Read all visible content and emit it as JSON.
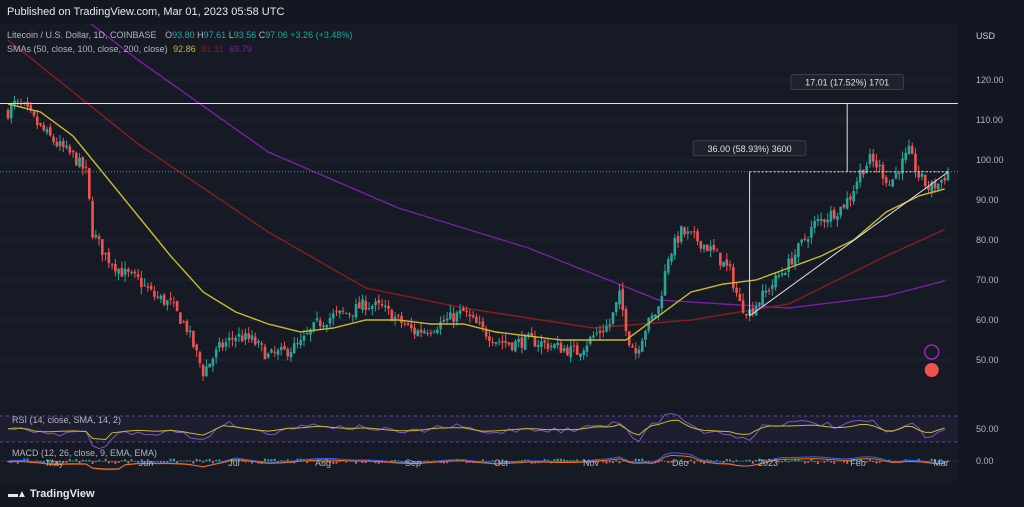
{
  "header": {
    "published": "Published on TradingView.com, Mar 01, 2023 05:58 UTC",
    "symbol_title": "Litecoin / U.S. Dollar, 1D, COINBASE",
    "ohlc": {
      "o_label": "O",
      "o": "93.80",
      "h_label": "H",
      "h": "97.61",
      "l_label": "L",
      "l": "93.56",
      "c_label": "C",
      "c": "97.06",
      "change": "+3.26 (+3.48%)"
    },
    "sma_label": "SMAs (50, close, 100, close, 200, close)",
    "sma_values": [
      "92.86",
      "81.31",
      "69.79"
    ],
    "currency": "USD"
  },
  "footer": {
    "brand": "TradingView"
  },
  "colors": {
    "background": "#161a25",
    "up": "#26a69a",
    "down": "#ef5350",
    "sma50": "#c9b92b",
    "sma100": "#8b1c1c",
    "sma200": "#7b1fa2",
    "rsi": "#7e57c2",
    "rsi_sma": "#c9b92b",
    "macd": "#2962ff",
    "signal": "#ff6d00"
  },
  "annotations": {
    "resistance_label": "114.12",
    "last_price_label": "97.06",
    "measure_big": "36.00 (58.93%) 3600",
    "measure_small": "17.01 (17.52%) 1701"
  },
  "chart_data": {
    "type": "candlestick",
    "title": "Litecoin / U.S. Dollar, 1D, COINBASE",
    "x_ticks": [
      "May",
      "Jun",
      "Jul",
      "Aug",
      "Sep",
      "Oct",
      "Nov",
      "Dec",
      "2023",
      "Feb",
      "Mar"
    ],
    "y_ticks": [
      "120.00",
      "110.00",
      "100.00",
      "90.00",
      "80.00",
      "70.00",
      "60.00",
      "50.00"
    ],
    "ylim": [
      44,
      124
    ],
    "price_path": [
      {
        "x": 0,
        "y": 112
      },
      {
        "x": 2,
        "y": 114
      },
      {
        "x": 5,
        "y": 113
      },
      {
        "x": 10,
        "y": 108
      },
      {
        "x": 15,
        "y": 104
      },
      {
        "x": 20,
        "y": 101
      },
      {
        "x": 24,
        "y": 97
      },
      {
        "x": 26,
        "y": 82
      },
      {
        "x": 30,
        "y": 76
      },
      {
        "x": 35,
        "y": 72
      },
      {
        "x": 40,
        "y": 70
      },
      {
        "x": 45,
        "y": 66
      },
      {
        "x": 50,
        "y": 64
      },
      {
        "x": 55,
        "y": 58
      },
      {
        "x": 60,
        "y": 47
      },
      {
        "x": 65,
        "y": 53
      },
      {
        "x": 70,
        "y": 56
      },
      {
        "x": 75,
        "y": 55
      },
      {
        "x": 80,
        "y": 51
      },
      {
        "x": 85,
        "y": 52
      },
      {
        "x": 90,
        "y": 54
      },
      {
        "x": 95,
        "y": 59
      },
      {
        "x": 100,
        "y": 61
      },
      {
        "x": 105,
        "y": 62
      },
      {
        "x": 110,
        "y": 64
      },
      {
        "x": 115,
        "y": 63
      },
      {
        "x": 120,
        "y": 60
      },
      {
        "x": 125,
        "y": 57
      },
      {
        "x": 130,
        "y": 58
      },
      {
        "x": 135,
        "y": 60
      },
      {
        "x": 140,
        "y": 62
      },
      {
        "x": 145,
        "y": 58
      },
      {
        "x": 150,
        "y": 55
      },
      {
        "x": 155,
        "y": 54
      },
      {
        "x": 160,
        "y": 55
      },
      {
        "x": 165,
        "y": 54
      },
      {
        "x": 170,
        "y": 53
      },
      {
        "x": 175,
        "y": 52
      },
      {
        "x": 180,
        "y": 56
      },
      {
        "x": 185,
        "y": 59
      },
      {
        "x": 188,
        "y": 66
      },
      {
        "x": 191,
        "y": 55
      },
      {
        "x": 193,
        "y": 52
      },
      {
        "x": 196,
        "y": 58
      },
      {
        "x": 200,
        "y": 63
      },
      {
        "x": 203,
        "y": 76
      },
      {
        "x": 207,
        "y": 82
      },
      {
        "x": 212,
        "y": 80
      },
      {
        "x": 217,
        "y": 77
      },
      {
        "x": 222,
        "y": 72
      },
      {
        "x": 225,
        "y": 64
      },
      {
        "x": 228,
        "y": 62
      },
      {
        "x": 232,
        "y": 66
      },
      {
        "x": 236,
        "y": 70
      },
      {
        "x": 240,
        "y": 74
      },
      {
        "x": 244,
        "y": 79
      },
      {
        "x": 248,
        "y": 84
      },
      {
        "x": 252,
        "y": 86
      },
      {
        "x": 256,
        "y": 88
      },
      {
        "x": 259,
        "y": 91
      },
      {
        "x": 262,
        "y": 97
      },
      {
        "x": 265,
        "y": 100
      },
      {
        "x": 268,
        "y": 98
      },
      {
        "x": 271,
        "y": 94
      },
      {
        "x": 274,
        "y": 98
      },
      {
        "x": 277,
        "y": 102
      },
      {
        "x": 280,
        "y": 96
      },
      {
        "x": 283,
        "y": 93
      },
      {
        "x": 286,
        "y": 94
      },
      {
        "x": 289,
        "y": 97.06
      }
    ],
    "sma_path": [
      {
        "x": 0,
        "y": 114
      },
      {
        "x": 10,
        "y": 112
      },
      {
        "x": 20,
        "y": 106
      },
      {
        "x": 30,
        "y": 96
      },
      {
        "x": 40,
        "y": 86
      },
      {
        "x": 50,
        "y": 76
      },
      {
        "x": 60,
        "y": 67
      },
      {
        "x": 70,
        "y": 62
      },
      {
        "x": 80,
        "y": 59
      },
      {
        "x": 90,
        "y": 57
      },
      {
        "x": 100,
        "y": 58
      },
      {
        "x": 110,
        "y": 60
      },
      {
        "x": 120,
        "y": 60
      },
      {
        "x": 130,
        "y": 59
      },
      {
        "x": 140,
        "y": 59
      },
      {
        "x": 150,
        "y": 57
      },
      {
        "x": 160,
        "y": 56
      },
      {
        "x": 170,
        "y": 55
      },
      {
        "x": 180,
        "y": 55
      },
      {
        "x": 190,
        "y": 55
      },
      {
        "x": 200,
        "y": 61
      },
      {
        "x": 210,
        "y": 67
      },
      {
        "x": 220,
        "y": 69
      },
      {
        "x": 230,
        "y": 70
      },
      {
        "x": 240,
        "y": 73
      },
      {
        "x": 250,
        "y": 76
      },
      {
        "x": 260,
        "y": 80
      },
      {
        "x": 270,
        "y": 87
      },
      {
        "x": 280,
        "y": 91
      },
      {
        "x": 289,
        "y": 93
      }
    ],
    "rsi_ticks": [
      "50.00"
    ],
    "macd_ticks": [
      "0.00"
    ]
  }
}
